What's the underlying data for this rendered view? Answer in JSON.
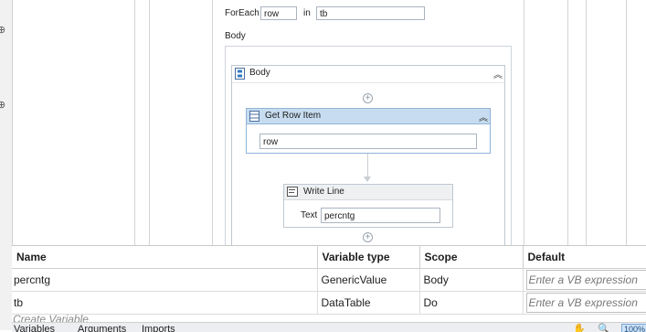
{
  "foreach": {
    "label": "ForEach",
    "item": "row",
    "in_label": "in",
    "collection": "tb"
  },
  "body_label": "Body",
  "sequence": {
    "title": "Body"
  },
  "get_row_item": {
    "title": "Get Row Item",
    "value": "row"
  },
  "write_line": {
    "title": "Write Line",
    "text_label": "Text",
    "text_value": "percntg"
  },
  "variables": {
    "columns": [
      "Name",
      "Variable type",
      "Scope",
      "Default"
    ],
    "rows": [
      {
        "name": "percntg",
        "type": "GenericValue",
        "scope": "Body",
        "default": "Enter a VB expression"
      },
      {
        "name": "tb",
        "type": "DataTable",
        "scope": "Do",
        "default": "Enter a VB expression"
      }
    ],
    "create_label": "Create Variable"
  },
  "bottom_tabs": {
    "variables": "Variables",
    "arguments": "Arguments",
    "imports": "Imports"
  },
  "zoom": "100%",
  "colors": {
    "accent_header": "#c7dcf0",
    "accent_border": "#8fb4d9",
    "zoom_badge": "#cfe3f7"
  }
}
